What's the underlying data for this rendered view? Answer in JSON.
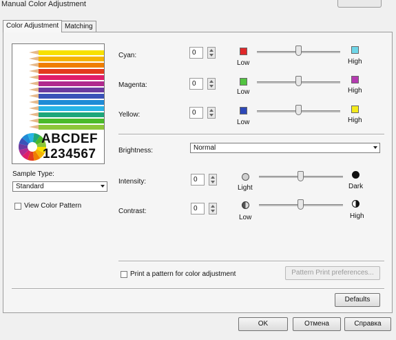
{
  "window": {
    "title": "Manual Color Adjustment"
  },
  "tabs": [
    {
      "label": "Color Adjustment",
      "active": true
    },
    {
      "label": "Matching",
      "active": false
    }
  ],
  "preview": {
    "text_line1": "ABCDEF",
    "text_line2": "1234567",
    "pencil_colors": [
      "#f7e100",
      "#f5b400",
      "#f07e00",
      "#e33b1e",
      "#e01e6a",
      "#b02a8e",
      "#6b3aa0",
      "#3a52b8",
      "#1f8bd6",
      "#28b3e6",
      "#1ea67a",
      "#4aba2a",
      "#8cc63a"
    ]
  },
  "sample_type": {
    "label": "Sample Type:",
    "value": "Standard"
  },
  "view_color_pattern": {
    "label": "View Color Pattern",
    "checked": false
  },
  "color_rows": [
    {
      "label": "Cyan:",
      "value": "0",
      "low": "Low",
      "high": "High",
      "low_color": "#e0282a",
      "high_color": "#6fd6e8",
      "slider": 0.5
    },
    {
      "label": "Magenta:",
      "value": "0",
      "low": "Low",
      "high": "High",
      "low_color": "#52c441",
      "high_color": "#b43ab0",
      "slider": 0.5
    },
    {
      "label": "Yellow:",
      "value": "0",
      "low": "Low",
      "high": "High",
      "low_color": "#2d48b8",
      "high_color": "#f4ea1c",
      "slider": 0.5
    }
  ],
  "brightness": {
    "label": "Brightness:",
    "value": "Normal"
  },
  "tone_rows": [
    {
      "label": "Intensity:",
      "value": "0",
      "low": "Light",
      "high": "Dark",
      "low_icon": "light-circle-icon",
      "high_icon": "dark-circle-icon",
      "slider": 0.5
    },
    {
      "label": "Contrast:",
      "value": "0",
      "low": "Low",
      "high": "High",
      "low_icon": "low-contrast-icon",
      "high_icon": "high-contrast-icon",
      "slider": 0.5
    }
  ],
  "print_pattern": {
    "label": "Print a pattern for color adjustment",
    "checked": false
  },
  "buttons": {
    "pattern_print_prefs": "Pattern Print preferences...",
    "defaults": "Defaults",
    "ok": "OK",
    "cancel": "Отмена",
    "help": "Справка"
  },
  "colors": {
    "window_bg": "#f0f0f0",
    "panel_bg": "#f5f5f5",
    "border": "#9b9b9b"
  }
}
